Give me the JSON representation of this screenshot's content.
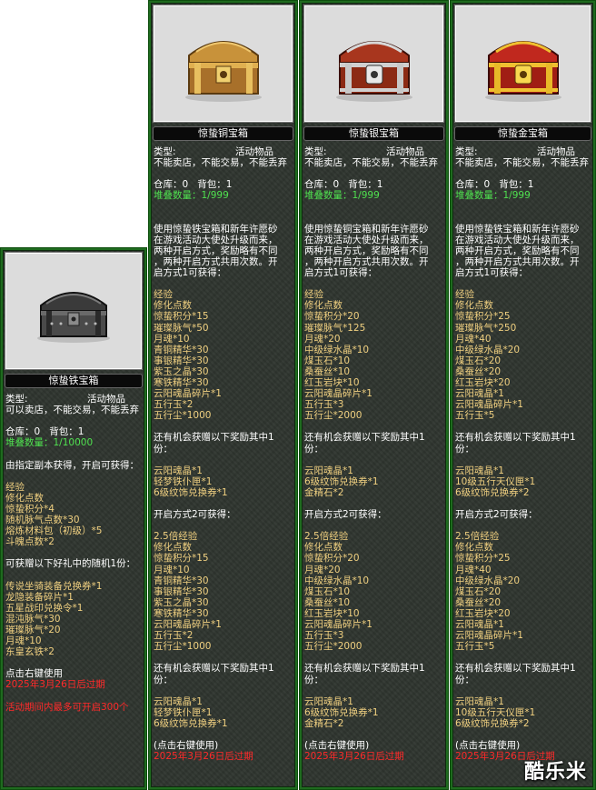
{
  "panels": [
    {
      "id": "iron",
      "name": "惊蛰铁宝箱",
      "type_label": "类型:",
      "type_value": "活动物品",
      "trade": "可以卖店，不能交易，不能丢弃",
      "storage": "仓库：0   背包：1",
      "stack": "堆叠数量：1/10000",
      "lines": [
        {
          "t": "",
          "c": "w"
        },
        {
          "t": "由指定副本获得，开启可获得：",
          "c": "w"
        },
        {
          "t": "",
          "c": "w"
        },
        {
          "t": "经验",
          "c": "y"
        },
        {
          "t": "修化点数",
          "c": "y"
        },
        {
          "t": "惊蛰积分*4",
          "c": "y"
        },
        {
          "t": "随机脉气点数*30",
          "c": "y"
        },
        {
          "t": "熔炼材料包（初级）*5",
          "c": "y"
        },
        {
          "t": "斗魄点数*2",
          "c": "y"
        },
        {
          "t": "",
          "c": "w"
        },
        {
          "t": "可获赠以下好礼中的随机1份：",
          "c": "w"
        },
        {
          "t": "",
          "c": "w"
        },
        {
          "t": "传说坐骑装备兑换券*1",
          "c": "y"
        },
        {
          "t": "龙隐装备碎片*1",
          "c": "y"
        },
        {
          "t": "五星战印兑换令*1",
          "c": "y"
        },
        {
          "t": "混沌脉气*30",
          "c": "y"
        },
        {
          "t": "璀璨脉气*20",
          "c": "y"
        },
        {
          "t": "月魂*10",
          "c": "y"
        },
        {
          "t": "东皇玄铁*2",
          "c": "y"
        },
        {
          "t": "",
          "c": "w"
        },
        {
          "t": "点击右键使用",
          "c": "w"
        },
        {
          "t": "2025年3月26日后过期",
          "c": "r"
        },
        {
          "t": "",
          "c": "w"
        },
        {
          "t": "活动期间内最多可开启300个",
          "c": "r"
        }
      ]
    },
    {
      "id": "copper",
      "name": "惊蛰铜宝箱",
      "type_label": "类型:",
      "type_value": "活动物品",
      "trade": "不能卖店，不能交易，不能丢弃",
      "storage": "仓库：0   背包：1",
      "stack": "堆叠数量：1/999",
      "lines": [
        {
          "t": "",
          "c": "w"
        },
        {
          "t": "",
          "c": "w"
        },
        {
          "t": "使用惊蛰铁宝箱和新年许愿砂",
          "c": "w"
        },
        {
          "t": "在游戏活动大使处升级而来，",
          "c": "w"
        },
        {
          "t": "两种开启方式，奖励略有不同",
          "c": "w"
        },
        {
          "t": "，两种开启方式共用次数。开",
          "c": "w"
        },
        {
          "t": "启方式1可获得：",
          "c": "w"
        },
        {
          "t": "",
          "c": "w"
        },
        {
          "t": "经验",
          "c": "y"
        },
        {
          "t": "修化点数",
          "c": "y"
        },
        {
          "t": "惊蛰积分*15",
          "c": "y"
        },
        {
          "t": "璀璨脉气*50",
          "c": "y"
        },
        {
          "t": "月魂*10",
          "c": "y"
        },
        {
          "t": "青铜精华*30",
          "c": "y"
        },
        {
          "t": "事银精华*30",
          "c": "y"
        },
        {
          "t": "紫玉之晶*30",
          "c": "y"
        },
        {
          "t": "寒铁精华*30",
          "c": "y"
        },
        {
          "t": "云阳魂晶碎片*1",
          "c": "y"
        },
        {
          "t": "五行玉*2",
          "c": "y"
        },
        {
          "t": "五行尘*1000",
          "c": "y"
        },
        {
          "t": "",
          "c": "w"
        },
        {
          "t": "还有机会获赠以下奖励其中1",
          "c": "w"
        },
        {
          "t": "份：",
          "c": "w"
        },
        {
          "t": "",
          "c": "w"
        },
        {
          "t": "云阳魂晶*1",
          "c": "y"
        },
        {
          "t": "轻梦铁仆匣*1",
          "c": "y"
        },
        {
          "t": "6级纹饰兑换券*1",
          "c": "y"
        },
        {
          "t": "",
          "c": "w"
        },
        {
          "t": "开启方式2可获得：",
          "c": "w"
        },
        {
          "t": "",
          "c": "w"
        },
        {
          "t": "2.5倍经验",
          "c": "y"
        },
        {
          "t": "修化点数",
          "c": "y"
        },
        {
          "t": "惊蛰积分*15",
          "c": "y"
        },
        {
          "t": "月魂*10",
          "c": "y"
        },
        {
          "t": "青铜精华*30",
          "c": "y"
        },
        {
          "t": "事银精华*30",
          "c": "y"
        },
        {
          "t": "紫玉之晶*30",
          "c": "y"
        },
        {
          "t": "寒铁精华*30",
          "c": "y"
        },
        {
          "t": "云阳魂晶碎片*1",
          "c": "y"
        },
        {
          "t": "五行玉*2",
          "c": "y"
        },
        {
          "t": "五行尘*1000",
          "c": "y"
        },
        {
          "t": "",
          "c": "w"
        },
        {
          "t": "还有机会获赠以下奖励其中1",
          "c": "w"
        },
        {
          "t": "份：",
          "c": "w"
        },
        {
          "t": "",
          "c": "w"
        },
        {
          "t": "云阳魂晶*1",
          "c": "y"
        },
        {
          "t": "轻梦铁仆匣*1",
          "c": "y"
        },
        {
          "t": "6级纹饰兑换券*1",
          "c": "y"
        },
        {
          "t": "",
          "c": "w"
        },
        {
          "t": "(点击右键使用)",
          "c": "w"
        },
        {
          "t": "2025年3月26日后过期",
          "c": "r"
        }
      ]
    },
    {
      "id": "silver",
      "name": "惊蛰银宝箱",
      "type_label": "类型:",
      "type_value": "活动物品",
      "trade": "不能卖店，不能交易，不能丢弃",
      "storage": "仓库：0   背包：1",
      "stack": "堆叠数量：1/999",
      "lines": [
        {
          "t": "",
          "c": "w"
        },
        {
          "t": "",
          "c": "w"
        },
        {
          "t": "使用惊蛰铜宝箱和新年许愿砂",
          "c": "w"
        },
        {
          "t": "在游戏活动大使处升级而来，",
          "c": "w"
        },
        {
          "t": "两种开启方式，奖励略有不同",
          "c": "w"
        },
        {
          "t": "，两种开启方式共用次数。开",
          "c": "w"
        },
        {
          "t": "启方式1可获得：",
          "c": "w"
        },
        {
          "t": "",
          "c": "w"
        },
        {
          "t": "经验",
          "c": "y"
        },
        {
          "t": "修化点数",
          "c": "y"
        },
        {
          "t": "惊蛰积分*20",
          "c": "y"
        },
        {
          "t": "璀璨脉气*125",
          "c": "y"
        },
        {
          "t": "月魂*20",
          "c": "y"
        },
        {
          "t": "中级绿水晶*10",
          "c": "y"
        },
        {
          "t": "煤玉石*10",
          "c": "y"
        },
        {
          "t": "桑蚕丝*10",
          "c": "y"
        },
        {
          "t": "红玉岩块*10",
          "c": "y"
        },
        {
          "t": "云阳魂晶碎片*1",
          "c": "y"
        },
        {
          "t": "五行玉*3",
          "c": "y"
        },
        {
          "t": "五行尘*2000",
          "c": "y"
        },
        {
          "t": "",
          "c": "w"
        },
        {
          "t": "还有机会获赠以下奖励其中1",
          "c": "w"
        },
        {
          "t": "份：",
          "c": "w"
        },
        {
          "t": "",
          "c": "w"
        },
        {
          "t": "云阳魂晶*1",
          "c": "y"
        },
        {
          "t": "6级纹饰兑换券*1",
          "c": "y"
        },
        {
          "t": "金精石*2",
          "c": "y"
        },
        {
          "t": "",
          "c": "w"
        },
        {
          "t": "开启方式2可获得：",
          "c": "w"
        },
        {
          "t": "",
          "c": "w"
        },
        {
          "t": "2.5倍经验",
          "c": "y"
        },
        {
          "t": "修化点数",
          "c": "y"
        },
        {
          "t": "惊蛰积分*20",
          "c": "y"
        },
        {
          "t": "月魂*20",
          "c": "y"
        },
        {
          "t": "中级绿水晶*10",
          "c": "y"
        },
        {
          "t": "煤玉石*10",
          "c": "y"
        },
        {
          "t": "桑蚕丝*10",
          "c": "y"
        },
        {
          "t": "红玉岩块*10",
          "c": "y"
        },
        {
          "t": "云阳魂晶碎片*1",
          "c": "y"
        },
        {
          "t": "五行玉*3",
          "c": "y"
        },
        {
          "t": "五行尘*2000",
          "c": "y"
        },
        {
          "t": "",
          "c": "w"
        },
        {
          "t": "还有机会获赠以下奖励其中1",
          "c": "w"
        },
        {
          "t": "份：",
          "c": "w"
        },
        {
          "t": "",
          "c": "w"
        },
        {
          "t": "云阳魂晶*1",
          "c": "y"
        },
        {
          "t": "6级纹饰兑换券*1",
          "c": "y"
        },
        {
          "t": "金精石*2",
          "c": "y"
        },
        {
          "t": "",
          "c": "w"
        },
        {
          "t": "(点击右键使用)",
          "c": "w"
        },
        {
          "t": "2025年3月26日后过期",
          "c": "r"
        }
      ]
    },
    {
      "id": "gold",
      "name": "惊蛰金宝箱",
      "type_label": "类型:",
      "type_value": "活动物品",
      "trade": "不能卖店，不能交易，不能丢弃",
      "storage": "仓库：0   背包：1",
      "stack": "堆叠数量：1/999",
      "lines": [
        {
          "t": "",
          "c": "w"
        },
        {
          "t": "",
          "c": "w"
        },
        {
          "t": "使用惊蛰铁宝箱和新年许愿砂",
          "c": "w"
        },
        {
          "t": "在游戏活动大使处升级而来，",
          "c": "w"
        },
        {
          "t": "两种开启方式，奖励略有不同",
          "c": "w"
        },
        {
          "t": "，两种开启方式共用次数。开",
          "c": "w"
        },
        {
          "t": "启方式1可获得：",
          "c": "w"
        },
        {
          "t": "",
          "c": "w"
        },
        {
          "t": "经验",
          "c": "y"
        },
        {
          "t": "修化点数",
          "c": "y"
        },
        {
          "t": "惊蛰积分*25",
          "c": "y"
        },
        {
          "t": "璀璨脉气*250",
          "c": "y"
        },
        {
          "t": "月魂*40",
          "c": "y"
        },
        {
          "t": "中级绿水晶*20",
          "c": "y"
        },
        {
          "t": "煤玉石*20",
          "c": "y"
        },
        {
          "t": "桑蚕丝*20",
          "c": "y"
        },
        {
          "t": "红玉岩块*20",
          "c": "y"
        },
        {
          "t": "云阳魂晶*1",
          "c": "y"
        },
        {
          "t": "云阳魂晶碎片*1",
          "c": "y"
        },
        {
          "t": "五行玉*5",
          "c": "y"
        },
        {
          "t": "",
          "c": "w"
        },
        {
          "t": "还有机会获赠以下奖励其中1",
          "c": "w"
        },
        {
          "t": "份：",
          "c": "w"
        },
        {
          "t": "",
          "c": "w"
        },
        {
          "t": "云阳魂晶*1",
          "c": "y"
        },
        {
          "t": "10级五行天仪匣*1",
          "c": "y"
        },
        {
          "t": "6级纹饰兑换券*2",
          "c": "y"
        },
        {
          "t": "",
          "c": "w"
        },
        {
          "t": "开启方式2可获得：",
          "c": "w"
        },
        {
          "t": "",
          "c": "w"
        },
        {
          "t": "2.5倍经验",
          "c": "y"
        },
        {
          "t": "修化点数",
          "c": "y"
        },
        {
          "t": "惊蛰积分*25",
          "c": "y"
        },
        {
          "t": "月魂*40",
          "c": "y"
        },
        {
          "t": "中级绿水晶*20",
          "c": "y"
        },
        {
          "t": "煤玉石*20",
          "c": "y"
        },
        {
          "t": "桑蚕丝*20",
          "c": "y"
        },
        {
          "t": "红玉岩块*20",
          "c": "y"
        },
        {
          "t": "云阳魂晶*1",
          "c": "y"
        },
        {
          "t": "云阳魂晶碎片*1",
          "c": "y"
        },
        {
          "t": "五行玉*5",
          "c": "y"
        },
        {
          "t": "",
          "c": "w"
        },
        {
          "t": "还有机会获赠以下奖励其中1",
          "c": "w"
        },
        {
          "t": "份：",
          "c": "w"
        },
        {
          "t": "",
          "c": "w"
        },
        {
          "t": "云阳魂晶*1",
          "c": "y"
        },
        {
          "t": "10级五行天仪匣*1",
          "c": "y"
        },
        {
          "t": "6级纹饰兑换券*2",
          "c": "y"
        },
        {
          "t": "",
          "c": "w"
        },
        {
          "t": "(点击右键使用)",
          "c": "w"
        },
        {
          "t": "2025年3月26日后过期",
          "c": "r"
        }
      ]
    }
  ],
  "watermark": "酷乐米",
  "colors": {
    "panel_bg": "#2e342e",
    "panel_border": "#1f6b1f",
    "reward_text": "#f0d080",
    "stack_text": "#4fe04f",
    "expire_text": "#ff2a2a",
    "iron_chest": "#5a5a5a",
    "copper_chest": "#c8923a",
    "silver_chest": "#a8361e",
    "gold_chest": "#c0281e"
  }
}
